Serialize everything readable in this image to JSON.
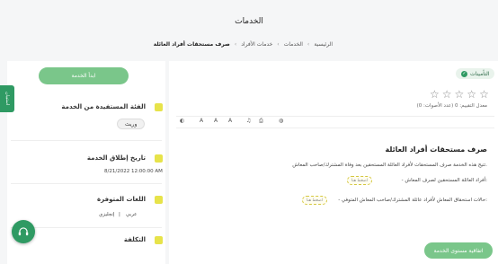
{
  "header": {
    "title": "الخدمات",
    "breadcrumb": [
      "الرئيسية",
      "الخدمات",
      "خدمات الأفراد",
      "صرف مستحقات أفراد العائلة"
    ]
  },
  "sidebar": {
    "start_button": "ابدأ الخدمة",
    "side_tab": "استبيان",
    "beneficiary": {
      "title": "الفئة المستفيدة من الخدمة",
      "value": "وريث"
    },
    "launch_date": {
      "title": "تاريخ إطلاق الخدمة",
      "value": "8/21/2022 12:00:00 AM"
    },
    "languages": {
      "title": "اللغات المتوفرة",
      "values": [
        "عربي",
        "إنجليزي"
      ]
    },
    "cost": {
      "title": "التكلفة"
    }
  },
  "main": {
    "badge": "التأمينات",
    "rating": {
      "stars_total": 5,
      "stars_filled": 0,
      "text": "معدل التقييم: 0 (عدد الأصوات: 0)"
    },
    "toolbar": [
      "A",
      "A",
      "A",
      "contrast"
    ],
    "content_title": "صرف مستحقات أفراد العائلة",
    "paragraph": "تتيح هذه الخدمة صرف المستحقات لأفراد العائلة المستحقين بعد وفاة المشترك/صاحب المعاش.",
    "items": [
      "- أفراد العائلة المستحقين لصرف المعاش:",
      "- حالات استحقاق المعاش لأفراد عائلة المشترك/صاحب المعاش المتوفي:"
    ],
    "chips": [
      "اضغط هنا",
      "اضغط هنا"
    ],
    "sla_button": "اتفاقية مستوى الخدمة"
  },
  "colors": {
    "primary": "#2f9a63",
    "button_light": "#7ac68a",
    "icon_yellow": "#e7e34a"
  }
}
